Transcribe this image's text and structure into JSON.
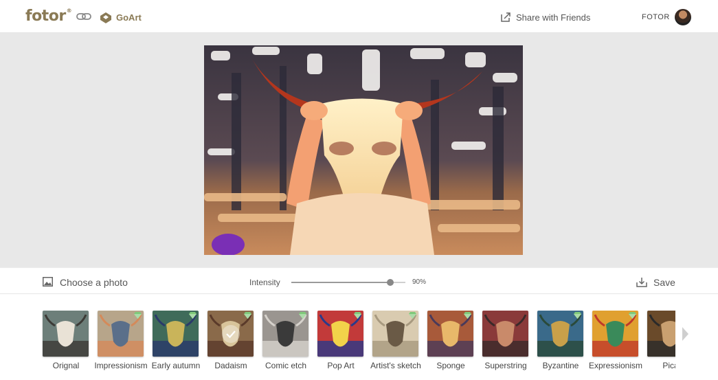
{
  "header": {
    "logo_text": "fotor",
    "logo_mark": "®",
    "link_icon": "link-icon",
    "goart_label": "GoArt",
    "share_label": "Share with Friends",
    "user_label": "FOTOR"
  },
  "colors": {
    "brand": "#8a7a55",
    "canvas_bg": "#e8e8e8",
    "premium_badge": "#7fc97a"
  },
  "toolbar": {
    "choose_photo_label": "Choose a photo",
    "intensity_label": "Intensity",
    "intensity_value": "90%",
    "intensity_fraction": 0.87,
    "save_label": "Save"
  },
  "filters": {
    "items": [
      {
        "label": "Orignal",
        "premium": false,
        "selected": false
      },
      {
        "label": "Impressionism",
        "premium": true,
        "selected": false
      },
      {
        "label": "Early autumn",
        "premium": true,
        "selected": false
      },
      {
        "label": "Dadaism",
        "premium": true,
        "selected": true
      },
      {
        "label": "Comic etch",
        "premium": true,
        "selected": false
      },
      {
        "label": "Pop Art",
        "premium": true,
        "selected": false
      },
      {
        "label": "Artist's sketch",
        "premium": true,
        "selected": false
      },
      {
        "label": "Sponge",
        "premium": true,
        "selected": false
      },
      {
        "label": "Superstring",
        "premium": false,
        "selected": false
      },
      {
        "label": "Byzantine",
        "premium": true,
        "selected": false
      },
      {
        "label": "Expressionism",
        "premium": true,
        "selected": false
      },
      {
        "label": "Pica",
        "premium": true,
        "selected": false
      }
    ],
    "next_icon": "chevron-right-icon"
  }
}
